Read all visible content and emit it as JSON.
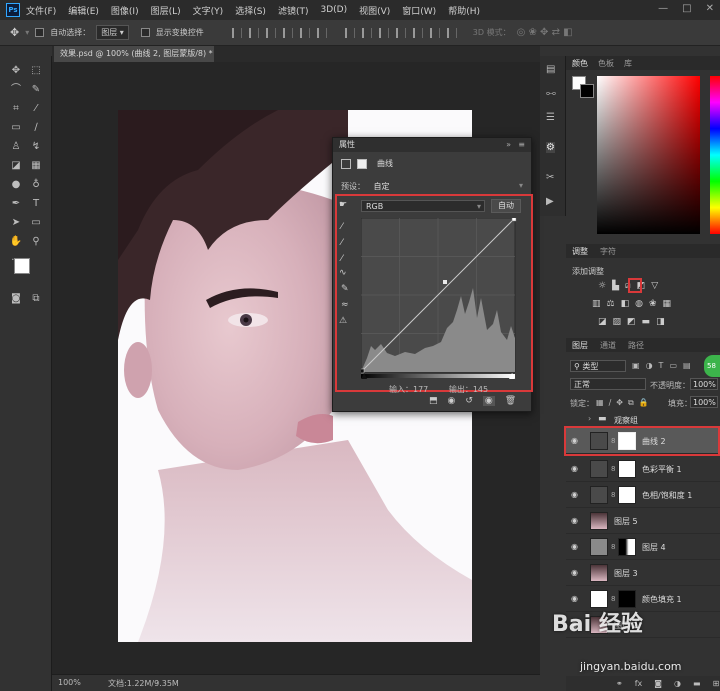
{
  "menubar": {
    "logo": "Ps",
    "items": [
      "文件(F)",
      "编辑(E)",
      "图像(I)",
      "图层(L)",
      "文字(Y)",
      "选择(S)",
      "滤镜(T)",
      "3D(D)",
      "视图(V)",
      "窗口(W)",
      "帮助(H)"
    ],
    "controls": [
      "—",
      "□",
      "✕"
    ]
  },
  "optbar": {
    "auto_select_label": "自动选择：",
    "auto_select_value": "图层",
    "show_transform_label": "显示变换控件",
    "mode_3d_label": "3D 模式："
  },
  "document": {
    "tab_title": "效果.psd @ 100% (曲线 2, 图层蒙版/8) *",
    "zoom": "100%",
    "doc_info": "文档:1.22M/9.35M"
  },
  "properties": {
    "panel_title": "属性",
    "adjustment_name": "曲线",
    "preset_label": "预设：",
    "preset_value": "自定",
    "channel_value": "RGB",
    "auto_button": "自动",
    "input_label": "输入：177",
    "output_label": "输出：145",
    "curve_point": {
      "input": 177,
      "output": 145
    }
  },
  "color_panel": {
    "tabs": [
      "颜色",
      "色板",
      "库"
    ]
  },
  "adjustments_panel": {
    "tabs": [
      "调整",
      "字符"
    ],
    "add_label": "添加调整"
  },
  "layers_panel": {
    "tabs": [
      "图层",
      "通道",
      "路径"
    ],
    "filter_value": "类型",
    "blend_mode": "正常",
    "opacity_label": "不透明度：",
    "opacity_value": "100%",
    "lock_label": "锁定：",
    "fill_label": "填充：",
    "fill_value": "100%",
    "group_name": "观察组",
    "layers": [
      {
        "name": "曲线 2",
        "selected": true
      },
      {
        "name": "色彩平衡 1",
        "selected": false
      },
      {
        "name": "色相/饱和度 1",
        "selected": false
      },
      {
        "name": "图层 5",
        "selected": false
      },
      {
        "name": "图层 4",
        "selected": false
      },
      {
        "name": "图层 3",
        "selected": false
      },
      {
        "name": "颜色填充 1",
        "selected": false
      },
      {
        "name": "图层 2",
        "selected": false
      }
    ]
  },
  "watermark": {
    "text": "Bai 经验",
    "url": "jingyan.baidu.com"
  },
  "colors": {
    "highlight_red": "#d9393a",
    "bg_dark": "#323232",
    "panel": "#3c3c3c"
  }
}
